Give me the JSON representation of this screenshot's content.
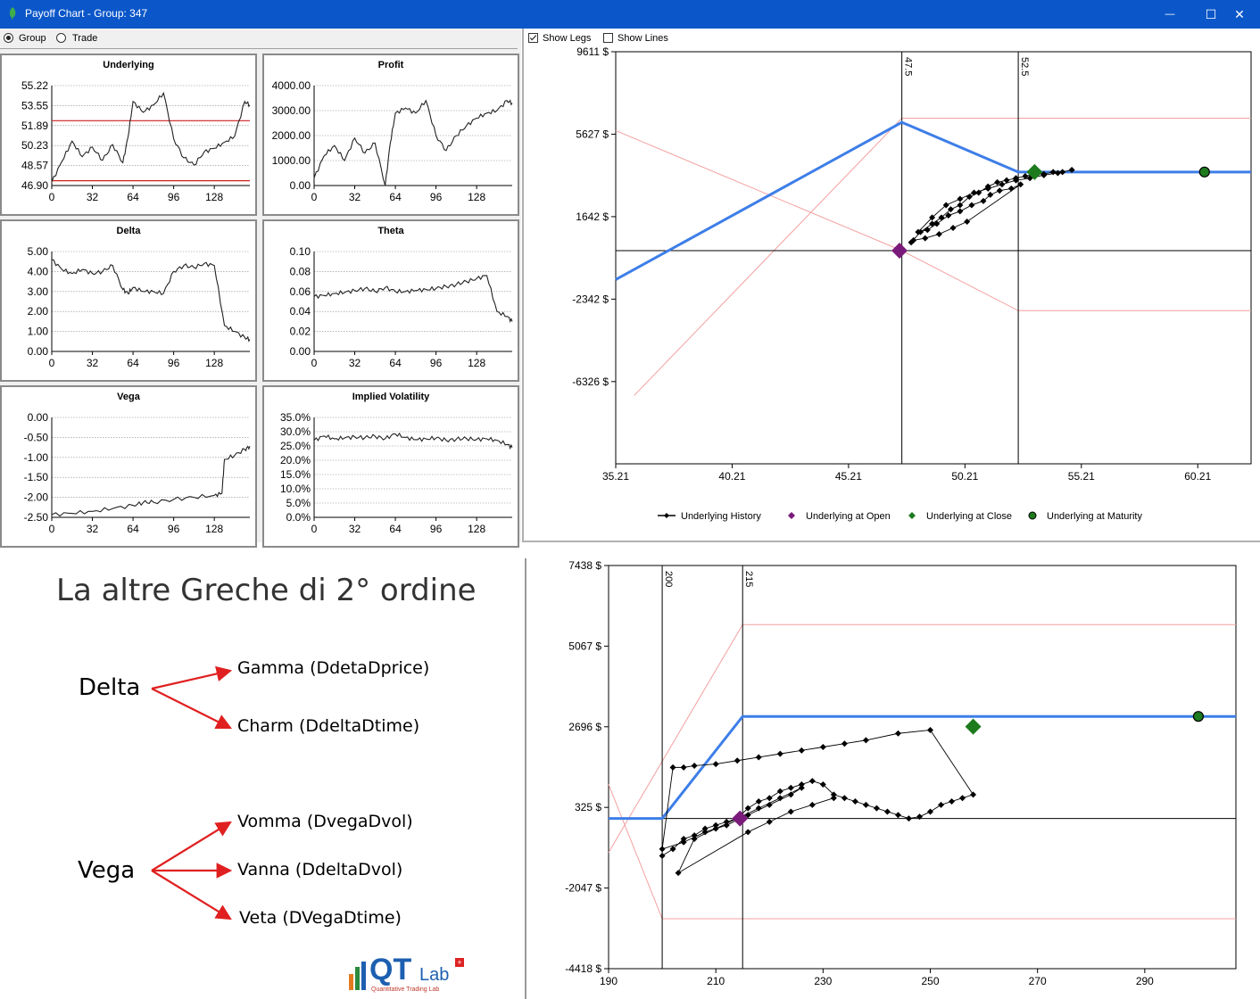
{
  "window": {
    "title": "Payoff Chart - Group: 347",
    "minimize": "—",
    "maximize": "☐",
    "close": "✕"
  },
  "mode": {
    "group_label": "Group",
    "trade_label": "Trade",
    "selected": "Group"
  },
  "options": {
    "show_legs_label": "Show Legs",
    "show_legs_checked": true,
    "show_lines_label": "Show Lines",
    "show_lines_checked": false
  },
  "colors": {
    "payoff_line": "#3d7ee8",
    "leg_lines": "#f4a0a0",
    "open_marker": "#7a1a7a",
    "close_marker": "#1d7a1d",
    "maturity_marker": "#1d7a1d",
    "titlebar": "#0b57c9"
  },
  "mini_charts": [
    {
      "title": "Underlying",
      "y_ticks": [
        "55.22",
        "53.55",
        "51.89",
        "50.23",
        "48.57",
        "46.90"
      ],
      "x_ticks": [
        "0",
        "32",
        "64",
        "96",
        "128"
      ]
    },
    {
      "title": "Profit",
      "y_ticks": [
        "4000.00",
        "3000.00",
        "2000.00",
        "1000.00",
        "0.00"
      ],
      "x_ticks": [
        "0",
        "32",
        "64",
        "96",
        "128"
      ]
    },
    {
      "title": "Delta",
      "y_ticks": [
        "5.00",
        "4.00",
        "3.00",
        "2.00",
        "1.00",
        "0.00"
      ],
      "x_ticks": [
        "0",
        "32",
        "64",
        "96",
        "128"
      ]
    },
    {
      "title": "Theta",
      "y_ticks": [
        "0.10",
        "0.08",
        "0.06",
        "0.04",
        "0.02",
        "0.00"
      ],
      "x_ticks": [
        "0",
        "32",
        "64",
        "96",
        "128"
      ]
    },
    {
      "title": "Vega",
      "y_ticks": [
        "0.00",
        "-0.50",
        "-1.00",
        "-1.50",
        "-2.00",
        "-2.50"
      ],
      "x_ticks": [
        "0",
        "32",
        "64",
        "96",
        "128"
      ]
    },
    {
      "title": "Implied Volatility",
      "y_ticks": [
        "35.0%",
        "30.0%",
        "25.0%",
        "20.0%",
        "15.0%",
        "10.0%",
        "5.0%",
        "0.0%"
      ],
      "x_ticks": [
        "0",
        "32",
        "64",
        "96",
        "128"
      ]
    }
  ],
  "chart_data": [
    {
      "type": "line",
      "title": "Underlying",
      "x": [
        0,
        8,
        16,
        24,
        32,
        40,
        48,
        56,
        60,
        64,
        72,
        80,
        88,
        96,
        104,
        112,
        120,
        128,
        136,
        144,
        152,
        156
      ],
      "values": [
        47.2,
        48.9,
        50.6,
        49.3,
        50.1,
        49.0,
        50.3,
        48.8,
        50.9,
        53.9,
        53.0,
        53.6,
        54.6,
        50.8,
        49.2,
        48.6,
        49.7,
        50.0,
        50.5,
        51.0,
        53.9,
        53.6
      ],
      "red_lines": [
        52.3,
        47.3
      ],
      "ylim": [
        46.9,
        55.22
      ],
      "xlim": [
        0,
        156
      ]
    },
    {
      "type": "line",
      "title": "Profit",
      "x": [
        0,
        8,
        16,
        24,
        32,
        40,
        48,
        56,
        60,
        64,
        72,
        80,
        88,
        96,
        104,
        112,
        120,
        128,
        136,
        144,
        152,
        156
      ],
      "values": [
        300,
        1200,
        1600,
        1000,
        1900,
        1300,
        1700,
        0,
        1700,
        2900,
        3100,
        2900,
        3400,
        2000,
        1400,
        2000,
        2400,
        2700,
        2900,
        3000,
        3400,
        3300
      ],
      "ylim": [
        0,
        4000
      ],
      "xlim": [
        0,
        156
      ]
    },
    {
      "type": "line",
      "title": "Delta",
      "x": [
        0,
        8,
        16,
        24,
        32,
        40,
        48,
        56,
        60,
        64,
        72,
        80,
        88,
        96,
        104,
        112,
        120,
        128,
        136,
        144,
        152,
        156
      ],
      "values": [
        4.6,
        4.1,
        3.9,
        4.1,
        3.9,
        4.0,
        4.3,
        3.1,
        2.9,
        3.2,
        3.0,
        3.0,
        2.9,
        4.0,
        4.3,
        4.2,
        4.4,
        4.3,
        1.3,
        1.0,
        0.7,
        0.6
      ],
      "ylim": [
        0,
        5
      ],
      "xlim": [
        0,
        156
      ]
    },
    {
      "type": "line",
      "title": "Theta",
      "x": [
        0,
        8,
        16,
        24,
        32,
        40,
        48,
        56,
        64,
        72,
        80,
        88,
        96,
        104,
        112,
        120,
        128,
        136,
        144,
        152,
        156
      ],
      "values": [
        0.055,
        0.056,
        0.058,
        0.059,
        0.061,
        0.063,
        0.06,
        0.064,
        0.06,
        0.06,
        0.061,
        0.062,
        0.063,
        0.065,
        0.067,
        0.07,
        0.073,
        0.076,
        0.04,
        0.035,
        0.03
      ],
      "ylim": [
        0,
        0.1
      ],
      "xlim": [
        0,
        156
      ]
    },
    {
      "type": "line",
      "title": "Vega",
      "x": [
        0,
        16,
        32,
        48,
        64,
        72,
        80,
        96,
        112,
        128,
        134,
        136,
        144,
        152,
        156
      ],
      "values": [
        -2.43,
        -2.4,
        -2.35,
        -2.28,
        -2.2,
        -2.13,
        -2.12,
        -2.05,
        -2.0,
        -1.95,
        -1.9,
        -1.05,
        -0.95,
        -0.8,
        -0.72
      ],
      "ylim": [
        -2.5,
        0
      ],
      "xlim": [
        0,
        156
      ]
    },
    {
      "type": "line",
      "title": "Implied Volatility",
      "x": [
        0,
        8,
        16,
        24,
        32,
        40,
        48,
        56,
        64,
        72,
        80,
        88,
        96,
        104,
        112,
        120,
        128,
        136,
        144,
        152,
        156
      ],
      "values": [
        27.0,
        28.5,
        27.5,
        27.8,
        28.2,
        27.9,
        28.4,
        27.6,
        29.2,
        28.0,
        27.2,
        27.5,
        27.8,
        27.0,
        27.4,
        27.6,
        27.3,
        27.5,
        27.0,
        25.5,
        24.5
      ],
      "ylim": [
        0,
        35
      ],
      "xlim": [
        0,
        156
      ]
    },
    {
      "type": "line",
      "title": "",
      "x_ticks": [
        "35.21",
        "40.21",
        "45.21",
        "50.21",
        "55.21",
        "60.21"
      ],
      "y_ticks": [
        "9611 $",
        "5627 $",
        "1642 $",
        "-2342 $",
        "-6326 $"
      ],
      "xlim": [
        35.21,
        62.5
      ],
      "ylim": [
        -10300,
        9611
      ],
      "strikes": [
        "47.5",
        "52.5"
      ],
      "strike_values": [
        47.5,
        52.5
      ],
      "payoff": {
        "x": [
          35.21,
          47.5,
          52.5,
          62.5
        ],
        "y": [
          -1400,
          6200,
          3800,
          3800
        ]
      },
      "legs": [
        {
          "x": [
            35.21,
            47.5,
            52.5,
            62.5
          ],
          "y": [
            5800,
            0,
            -2900,
            -2900
          ]
        },
        {
          "x": [
            36,
            47.5,
            62.5
          ],
          "y": [
            -7000,
            6400,
            6400
          ]
        }
      ],
      "zero_line": 0,
      "underlying_at_open": {
        "x": 47.4,
        "y": 0
      },
      "underlying_at_close": {
        "x": 53.2,
        "y": 3800
      },
      "underlying_at_maturity": {
        "x": 60.5,
        "y": 3800
      },
      "history": {
        "x": [
          47.9,
          48.3,
          48.8,
          49.2,
          49.6,
          50.0,
          50.4,
          50.8,
          51.2,
          51.6,
          52.0,
          52.4,
          52.8,
          53.2,
          53.6,
          54.0,
          54.4,
          54.8,
          54.2,
          53.6,
          53.0,
          52.4,
          51.8,
          51.2,
          50.6,
          50.0,
          49.4,
          48.8,
          48.2,
          48.6,
          49.0,
          49.5,
          50.0,
          50.5,
          51.0,
          51.3,
          51.7,
          52.2,
          52.6,
          50.3,
          49.7,
          49.1,
          48.5,
          48.0
        ],
        "y": [
          400,
          900,
          1300,
          1600,
          2000,
          2200,
          2600,
          2800,
          3100,
          3300,
          3400,
          3500,
          3600,
          3700,
          3700,
          3800,
          3800,
          3900,
          3750,
          3650,
          3500,
          3400,
          3200,
          3000,
          2800,
          2500,
          2200,
          1600,
          900,
          1000,
          1300,
          1700,
          1900,
          2200,
          2400,
          2700,
          2900,
          3000,
          3200,
          1400,
          1100,
          800,
          600,
          500
        ]
      },
      "legend": [
        "Underlying History",
        "Underlying at Open",
        "Underlying at Close",
        "Underlying at Maturity"
      ]
    },
    {
      "type": "line",
      "title": "",
      "x_ticks": [
        "190",
        "210",
        "230",
        "250",
        "270",
        "290"
      ],
      "y_ticks": [
        "7438 $",
        "5067 $",
        "2696 $",
        "325 $",
        "-2047 $",
        "-4418 $"
      ],
      "xlim": [
        190,
        307
      ],
      "ylim": [
        -4418,
        7438
      ],
      "strikes": [
        "200",
        "215"
      ],
      "strike_values": [
        200,
        215
      ],
      "payoff": {
        "x": [
          190,
          200,
          215,
          307
        ],
        "y": [
          0,
          0,
          3000,
          3000
        ]
      },
      "legs": [
        {
          "x": [
            190,
            215,
            307
          ],
          "y": [
            -1000,
            5700,
            5700
          ]
        },
        {
          "x": [
            190,
            200,
            307
          ],
          "y": [
            1000,
            -2950,
            -2950
          ]
        }
      ],
      "zero_line": 0,
      "underlying_at_open": {
        "x": 214.5,
        "y": 0
      },
      "underlying_at_close": {
        "x": 258,
        "y": 2700
      },
      "underlying_at_maturity": {
        "x": 300,
        "y": 3000
      },
      "history": {
        "x": [
          200,
          202,
          204,
          206,
          208,
          210,
          212,
          214,
          216,
          218,
          220,
          222,
          224,
          226,
          228,
          230,
          232,
          234,
          236,
          238,
          240,
          242,
          244,
          246,
          248,
          250,
          252,
          254,
          256,
          258,
          250,
          244,
          238,
          234,
          230,
          226,
          222,
          218,
          214,
          210,
          206,
          204,
          202,
          200,
          204,
          208,
          212,
          216,
          220,
          224,
          226,
          222,
          218,
          214,
          210,
          206,
          203,
          216,
          220,
          224,
          228,
          232
        ],
        "y": [
          -1100,
          -900,
          -600,
          -500,
          -300,
          -200,
          -100,
          0,
          300,
          500,
          600,
          800,
          900,
          1000,
          1100,
          1000,
          700,
          600,
          500,
          400,
          300,
          200,
          100,
          0,
          50,
          200,
          400,
          500,
          600,
          700,
          2600,
          2500,
          2300,
          2200,
          2100,
          2000,
          1900,
          1800,
          1700,
          1600,
          1550,
          1500,
          1500,
          -900,
          -700,
          -400,
          -200,
          100,
          400,
          700,
          900,
          600,
          300,
          0,
          -300,
          -600,
          -1600,
          -400,
          -100,
          200,
          400,
          600
        ]
      },
      "legend": []
    }
  ],
  "slide": {
    "heading": "La altre Greche di 2° ordine",
    "delta_label": "Delta",
    "gamma_label": "Gamma (DdetaDprice)",
    "charm_label": "Charm (DdeltaDtime)",
    "vega_label": "Vega",
    "vomma_label": "Vomma (DvegaDvol)",
    "vanna_label": "Vanna (DdeltaDvol)",
    "veta_label": "Veta (DVegaDtime)",
    "arrow_color": "#e02020",
    "logo_text_qt": "QT",
    "logo_text_lab": "Lab",
    "logo_sub": "Quantitative Trading Lab"
  }
}
